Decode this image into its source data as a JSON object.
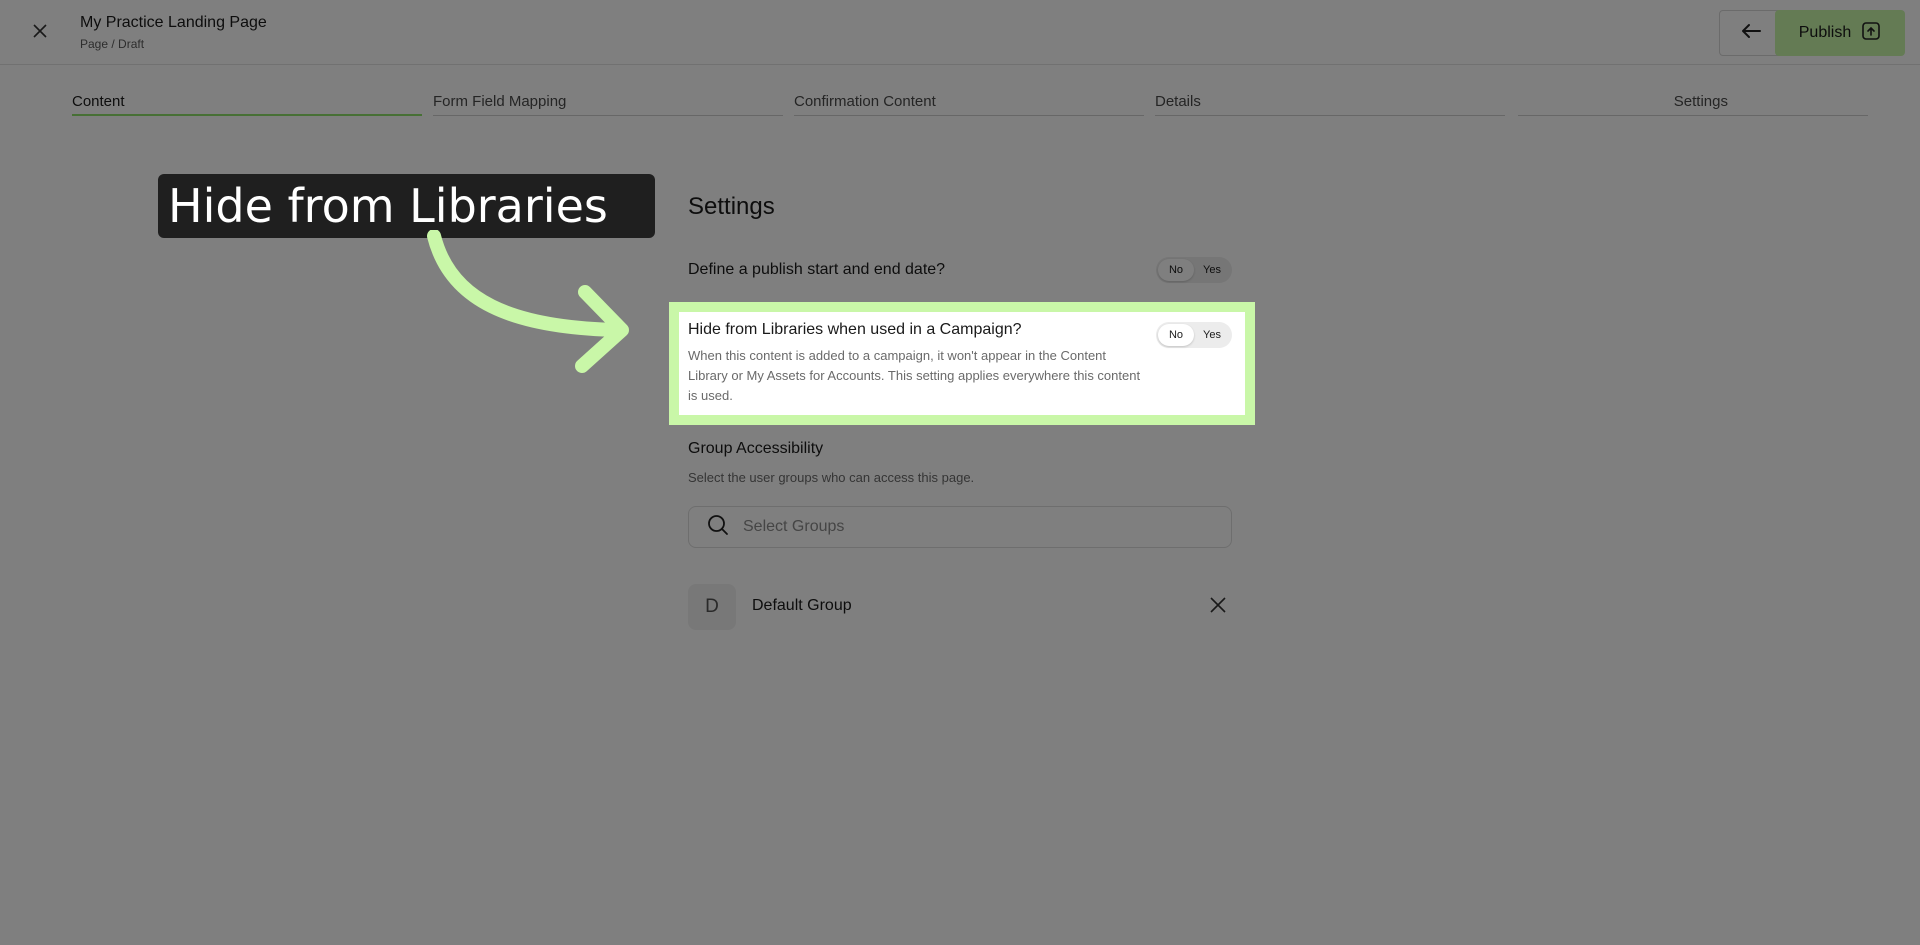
{
  "header": {
    "title": "My Practice Landing Page",
    "breadcrumb": "Page / Draft",
    "publish_label": "Publish",
    "close_icon": "close-icon",
    "back_icon": "arrow-left-icon",
    "publish_icon": "publish-icon"
  },
  "tabs": [
    {
      "label": "Content",
      "active": true
    },
    {
      "label": "Form Field Mapping",
      "active": false
    },
    {
      "label": "Confirmation Content",
      "active": false
    },
    {
      "label": "Details",
      "active": false
    },
    {
      "label": "Settings",
      "active": false
    }
  ],
  "settings": {
    "heading": "Settings",
    "publish_date": {
      "label": "Define a publish start and end date?",
      "toggle_no": "No",
      "toggle_yes": "Yes",
      "selected": "No"
    },
    "hide_libraries": {
      "label": "Hide from Libraries when used in a Campaign?",
      "description": "When this content is added to a campaign, it won't appear in the Content Library or My Assets for Accounts. This setting applies everywhere this content is used.",
      "toggle_no": "No",
      "toggle_yes": "Yes",
      "selected": "No"
    },
    "group_accessibility": {
      "heading": "Group Accessibility",
      "description": "Select the user groups who can access this page.",
      "search_placeholder": "Select Groups",
      "groups": [
        {
          "initial": "D",
          "name": "Default Group"
        }
      ]
    }
  },
  "guide": {
    "callout_text": "Hide from Libraries",
    "accent_color": "#c9f7a8"
  },
  "colors": {
    "accent": "#8fe06b",
    "publish_bg": "#c9f7a8",
    "callout_bg": "#1f1f1f"
  }
}
